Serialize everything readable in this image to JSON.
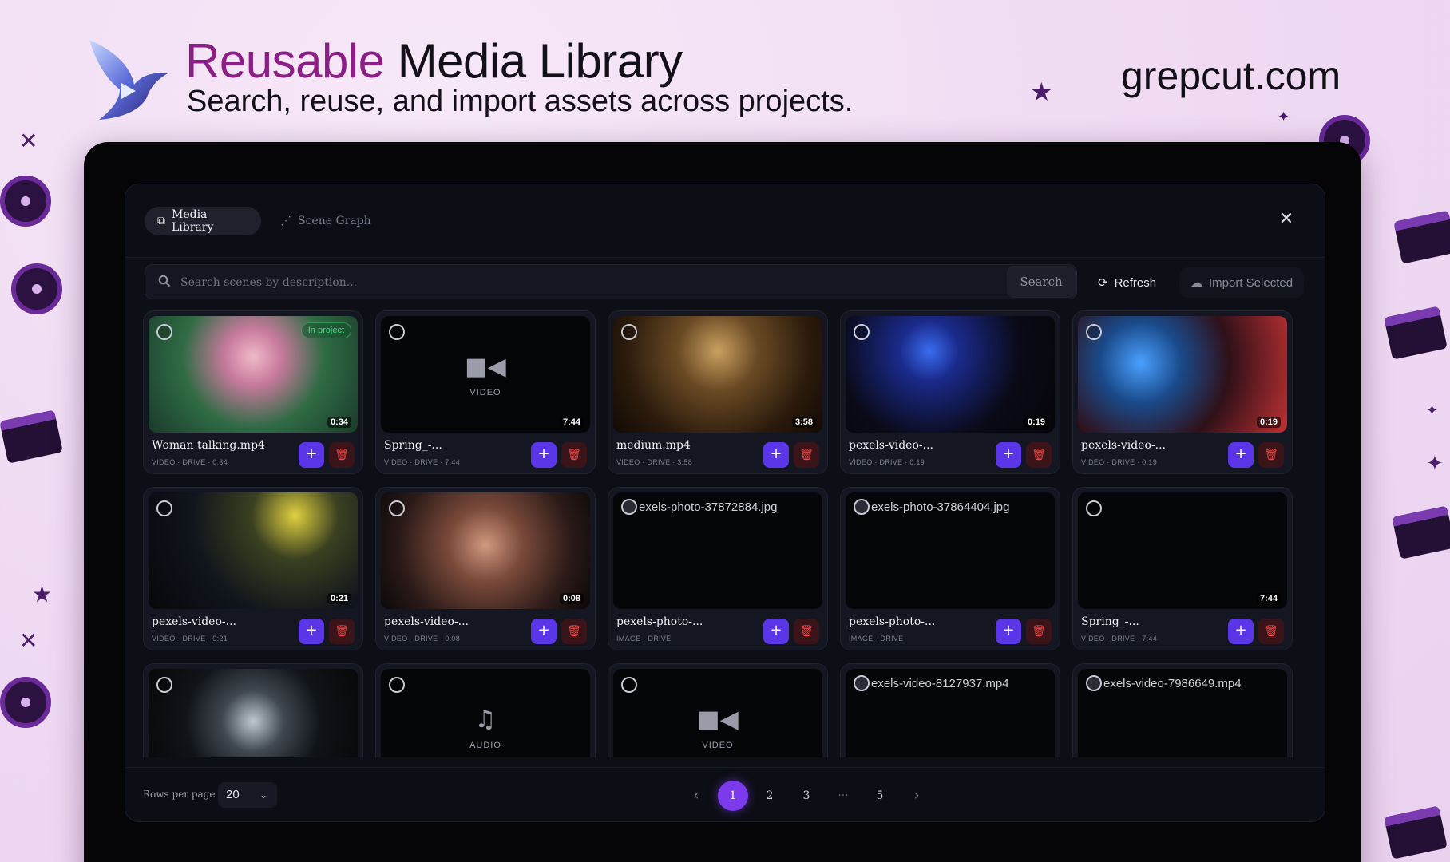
{
  "branding": {
    "headline_accent": "Reusable",
    "headline_rest": "Media Library",
    "subline": "Search, reuse, and import assets across projects.",
    "site": "grepcut.com"
  },
  "tabs": [
    {
      "label": "Media Library",
      "icon": "media-library-icon",
      "active": true
    },
    {
      "label": "Scene Graph",
      "icon": "scene-graph-icon",
      "active": false
    }
  ],
  "search": {
    "placeholder": "Search scenes by description...",
    "button_label": "Search"
  },
  "toolbar": {
    "refresh_label": "Refresh",
    "import_label": "Import Selected"
  },
  "cards": [
    {
      "name": "Woman talking.mp4",
      "meta": "VIDEO · DRIVE · 0:34",
      "duration": "0:34",
      "badge": "In project"
    },
    {
      "name": "Spring_-...",
      "meta": "VIDEO · DRIVE · 7:44",
      "duration": "7:44",
      "placeholder": "VIDEO"
    },
    {
      "name": "medium.mp4",
      "meta": "VIDEO · DRIVE · 3:58",
      "duration": "3:58"
    },
    {
      "name": "pexels-video-...",
      "meta": "VIDEO · DRIVE · 0:19",
      "duration": "0:19"
    },
    {
      "name": "pexels-video-...",
      "meta": "VIDEO · DRIVE · 0:19",
      "duration": "0:19"
    },
    {
      "name": "pexels-video-...",
      "meta": "VIDEO · DRIVE · 0:21",
      "duration": "0:21"
    },
    {
      "name": "pexels-video-...",
      "meta": "VIDEO · DRIVE · 0:08",
      "duration": "0:08"
    },
    {
      "name": "pexels-photo-...",
      "meta": "IMAGE · DRIVE",
      "broken_alt": "exels-photo-37872884.jpg"
    },
    {
      "name": "pexels-photo-...",
      "meta": "IMAGE · DRIVE",
      "broken_alt": "exels-photo-37864404.jpg"
    },
    {
      "name": "Spring_-...",
      "meta": "VIDEO · DRIVE · 7:44",
      "duration": "7:44"
    },
    {
      "name": "",
      "meta": ""
    },
    {
      "name": "",
      "meta": "",
      "placeholder": "AUDIO"
    },
    {
      "name": "",
      "meta": "",
      "placeholder": "VIDEO"
    },
    {
      "name": "",
      "meta": "",
      "broken_alt": "exels-video-8127937.mp4"
    },
    {
      "name": "",
      "meta": "",
      "broken_alt": "exels-video-7986649.mp4"
    }
  ],
  "card_actions": {
    "add": "+",
    "delete": "🗑"
  },
  "footer": {
    "rows_label": "Rows per page",
    "rows_value": "20",
    "pages": [
      "1",
      "2",
      "3",
      "···",
      "5"
    ],
    "current_page": "1"
  },
  "colors": {
    "accent": "#7c3aed",
    "add_button": "#5b35e8",
    "delete": "#ef4444",
    "in_project": "#4ade80",
    "headline_accent": "#8b1f86"
  }
}
